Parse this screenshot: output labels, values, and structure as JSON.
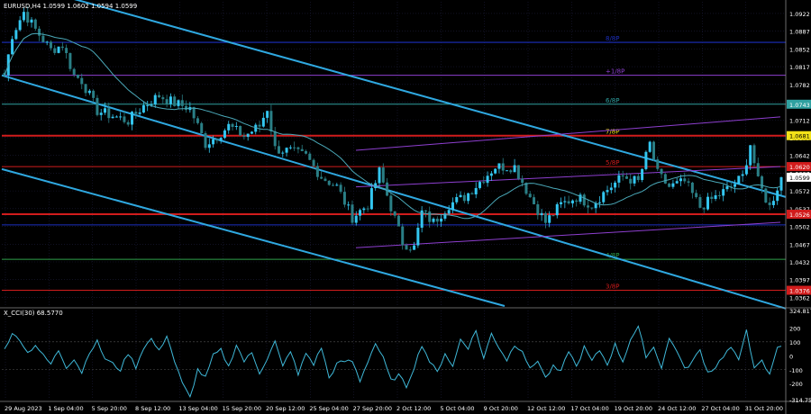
{
  "colors": {
    "background": "#000000",
    "grid": "#1c1c3a",
    "bull": "#33c6f0",
    "bear": "#2a7f86",
    "channel": "#2fa8e0",
    "ma": "#4aa8b8",
    "resistance": "#d11c1c",
    "purple": "#8e3fd0",
    "cci_line": "#3fb8d8"
  },
  "chart_data": [
    {
      "type": "candlestick",
      "title": "EURUSD,H4  1.0599 1.0602 1.0594 1.0599",
      "ylim": [
        1.0345,
        1.0945
      ],
      "yticks": [
        "1.0922",
        "1.0887",
        "1.0852",
        "1.0817",
        "1.0782",
        "1.0747",
        "1.0712",
        "1.0677",
        "1.0642",
        "1.0607",
        "1.0572",
        "1.0537",
        "1.0502",
        "1.0467",
        "1.0432",
        "1.0397",
        "1.0362"
      ],
      "xticks": [
        "29 Aug 2023",
        "1 Sep 04:00",
        "5 Sep 20:00",
        "8 Sep 12:00",
        "13 Sep 04:00",
        "15 Sep 20:00",
        "20 Sep 12:00",
        "25 Sep 04:00",
        "27 Sep 20:00",
        "2 Oct 12:00",
        "5 Oct 04:00",
        "9 Oct 20:00",
        "12 Oct 12:00",
        "17 Oct 04:00",
        "19 Oct 20:00",
        "24 Oct 12:00",
        "27 Oct 04:00",
        "31 Oct 20:00"
      ],
      "anchors": [
        [
          0,
          1.08
        ],
        [
          2,
          1.088
        ],
        [
          5,
          1.0925
        ],
        [
          8,
          1.089
        ],
        [
          12,
          1.085
        ],
        [
          15,
          1.086
        ],
        [
          18,
          1.08
        ],
        [
          20,
          1.079
        ],
        [
          24,
          1.073
        ],
        [
          28,
          1.072
        ],
        [
          32,
          1.071
        ],
        [
          36,
          1.074
        ],
        [
          40,
          1.076
        ],
        [
          44,
          1.0745
        ],
        [
          48,
          1.0735
        ],
        [
          52,
          1.0665
        ],
        [
          55,
          1.068
        ],
        [
          58,
          1.07
        ],
        [
          62,
          1.068
        ],
        [
          66,
          1.07
        ],
        [
          68,
          1.0735
        ],
        [
          70,
          1.0655
        ],
        [
          74,
          1.065
        ],
        [
          78,
          1.064
        ],
        [
          82,
          1.06
        ],
        [
          86,
          1.058
        ],
        [
          90,
          1.052
        ],
        [
          94,
          1.0545
        ],
        [
          97,
          1.061
        ],
        [
          100,
          1.054
        ],
        [
          103,
          1.047
        ],
        [
          106,
          1.046
        ],
        [
          108,
          1.053
        ],
        [
          111,
          1.051
        ],
        [
          115,
          1.0545
        ],
        [
          119,
          1.056
        ],
        [
          123,
          1.059
        ],
        [
          127,
          1.062
        ],
        [
          132,
          1.062
        ],
        [
          136,
          1.056
        ],
        [
          140,
          1.051
        ],
        [
          144,
          1.0545
        ],
        [
          148,
          1.056
        ],
        [
          152,
          1.0545
        ],
        [
          156,
          1.0575
        ],
        [
          160,
          1.06
        ],
        [
          164,
          1.059
        ],
        [
          167,
          1.0665
        ],
        [
          169,
          1.0605
        ],
        [
          172,
          1.058
        ],
        [
          176,
          1.059
        ],
        [
          180,
          1.054
        ],
        [
          184,
          1.056
        ],
        [
          188,
          1.058
        ],
        [
          191,
          1.06
        ],
        [
          193,
          1.0665
        ],
        [
          195,
          1.059
        ],
        [
          198,
          1.054
        ],
        [
          201,
          1.0599
        ]
      ],
      "price_labels": [
        {
          "text": "1.0681",
          "color": "#f2e218",
          "y": 1.0681
        },
        {
          "text": "1.0620",
          "color": "#d11c1c",
          "y": 1.062
        },
        {
          "text": "1.0599",
          "color": "#ffffff",
          "y": 1.0599
        },
        {
          "text": "1.0526",
          "color": "#d11c1c",
          "y": 1.0526
        },
        {
          "text": "1.0743",
          "color": "#2fa0a0",
          "y": 1.0743
        },
        {
          "text": "1.0376",
          "color": "#d11c1c",
          "y": 1.0376
        }
      ],
      "murrey_labels": [
        {
          "text": "8/8P",
          "color": "#1c2fbf",
          "y": 1.0865
        },
        {
          "text": "+1/8P",
          "color": "#8e3fd0",
          "y": 1.08
        },
        {
          "text": "6/8P",
          "color": "#2fa0a0",
          "y": 1.0743
        },
        {
          "text": "7/8P",
          "color": "#f2e218",
          "y": 1.0681
        },
        {
          "text": "5/8P",
          "color": "#d11c1c",
          "y": 1.062
        },
        {
          "text": "4/8P",
          "color": "#2fa04a",
          "y": 1.0437
        },
        {
          "text": "3/8P",
          "color": "#d11c1c",
          "y": 1.0376
        }
      ]
    },
    {
      "type": "line",
      "title": "X_CCI(30) 68.5770",
      "ylim": [
        -314.7588,
        324.8172
      ],
      "yticks": [
        "324.8172",
        "200",
        "100",
        "0",
        "-100",
        "-200",
        "-314.7588"
      ],
      "anchors": [
        [
          0,
          60
        ],
        [
          2,
          150
        ],
        [
          4,
          120
        ],
        [
          6,
          20
        ],
        [
          8,
          80
        ],
        [
          10,
          0
        ],
        [
          12,
          -60
        ],
        [
          14,
          40
        ],
        [
          16,
          -80
        ],
        [
          18,
          -20
        ],
        [
          20,
          -120
        ],
        [
          22,
          30
        ],
        [
          24,
          100
        ],
        [
          26,
          -20
        ],
        [
          28,
          -60
        ],
        [
          30,
          -100
        ],
        [
          32,
          20
        ],
        [
          34,
          -80
        ],
        [
          36,
          60
        ],
        [
          38,
          120
        ],
        [
          40,
          30
        ],
        [
          42,
          150
        ],
        [
          44,
          -40
        ],
        [
          46,
          -200
        ],
        [
          48,
          -300
        ],
        [
          50,
          -100
        ],
        [
          52,
          -160
        ],
        [
          54,
          0
        ],
        [
          56,
          40
        ],
        [
          58,
          -80
        ],
        [
          60,
          80
        ],
        [
          62,
          -40
        ],
        [
          64,
          20
        ],
        [
          66,
          -120
        ],
        [
          68,
          -20
        ],
        [
          70,
          100
        ],
        [
          72,
          -80
        ],
        [
          74,
          40
        ],
        [
          76,
          -140
        ],
        [
          78,
          20
        ],
        [
          80,
          -60
        ],
        [
          82,
          60
        ],
        [
          84,
          -160
        ],
        [
          86,
          -60
        ],
        [
          88,
          -40
        ],
        [
          90,
          -40
        ],
        [
          92,
          -180
        ],
        [
          94,
          -40
        ],
        [
          96,
          90
        ],
        [
          98,
          -20
        ],
        [
          100,
          -180
        ],
        [
          102,
          -140
        ],
        [
          104,
          -220
        ],
        [
          106,
          -80
        ],
        [
          108,
          80
        ],
        [
          110,
          -40
        ],
        [
          112,
          -120
        ],
        [
          114,
          20
        ],
        [
          116,
          -80
        ],
        [
          118,
          120
        ],
        [
          120,
          60
        ],
        [
          122,
          180
        ],
        [
          124,
          -20
        ],
        [
          126,
          160
        ],
        [
          128,
          60
        ],
        [
          130,
          -30
        ],
        [
          132,
          80
        ],
        [
          134,
          40
        ],
        [
          136,
          -100
        ],
        [
          138,
          -30
        ],
        [
          140,
          -160
        ],
        [
          142,
          -80
        ],
        [
          144,
          -120
        ],
        [
          146,
          40
        ],
        [
          148,
          -80
        ],
        [
          150,
          60
        ],
        [
          152,
          -40
        ],
        [
          154,
          40
        ],
        [
          156,
          -60
        ],
        [
          158,
          80
        ],
        [
          160,
          -40
        ],
        [
          162,
          120
        ],
        [
          164,
          200
        ],
        [
          166,
          0
        ],
        [
          168,
          60
        ],
        [
          170,
          -80
        ],
        [
          172,
          120
        ],
        [
          174,
          40
        ],
        [
          176,
          -100
        ],
        [
          178,
          -40
        ],
        [
          180,
          40
        ],
        [
          182,
          -120
        ],
        [
          184,
          -80
        ],
        [
          186,
          0
        ],
        [
          188,
          60
        ],
        [
          190,
          -40
        ],
        [
          192,
          200
        ],
        [
          194,
          -100
        ],
        [
          196,
          -40
        ],
        [
          198,
          -140
        ],
        [
          200,
          69
        ]
      ]
    }
  ]
}
